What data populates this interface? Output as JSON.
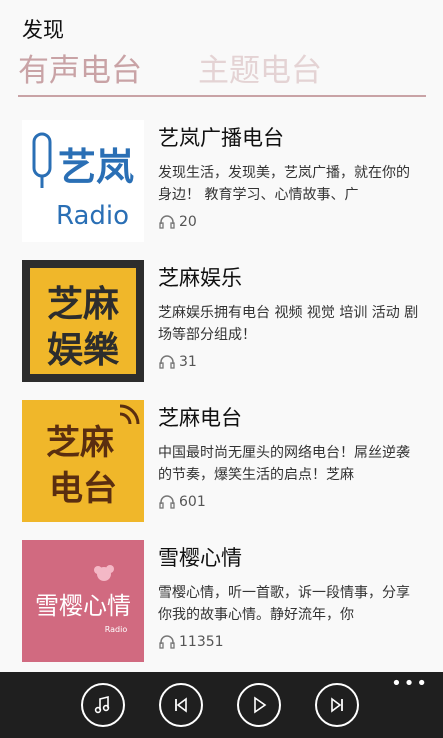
{
  "header": {
    "title": "发现"
  },
  "pivot": {
    "tabs": [
      {
        "label": "有声电台"
      },
      {
        "label": "主题电台"
      }
    ]
  },
  "stations": [
    {
      "title": "艺岚广播电台",
      "desc": "发现生活，发现美，艺岚广播，就在你的身边！ 教育学习、心情故事、广",
      "count": "20",
      "thumb_text": "艺岚",
      "thumb_sub": "Radio"
    },
    {
      "title": "芝麻娱乐",
      "desc": "芝麻娱乐拥有电台 视频 视觉 培训 活动 剧场等部分组成！",
      "count": "31",
      "thumb_text": "芝麻娱樂"
    },
    {
      "title": "芝麻电台",
      "desc": "中国最时尚无厘头的网络电台！屌丝逆袭的节奏，爆笑生活的启点！芝麻",
      "count": "601",
      "thumb_text": "芝麻电台"
    },
    {
      "title": "雪樱心情",
      "desc": "雪樱心情，听一首歌，诉一段情事，分享你我的故事心情。静好流年，你",
      "count": "11351",
      "thumb_text": "雪樱心情",
      "thumb_sub": "Radio"
    }
  ],
  "appbar": {
    "buttons": [
      {
        "icon": "music-note-icon"
      },
      {
        "icon": "previous-icon"
      },
      {
        "icon": "play-icon"
      },
      {
        "icon": "next-icon"
      }
    ],
    "more": "•••"
  },
  "colors": {
    "accent": "#c9a3a6",
    "appbar_bg": "#1f1f1f",
    "zhima_bg": "#f0b72a",
    "xueying_bg": "#d16a80"
  }
}
